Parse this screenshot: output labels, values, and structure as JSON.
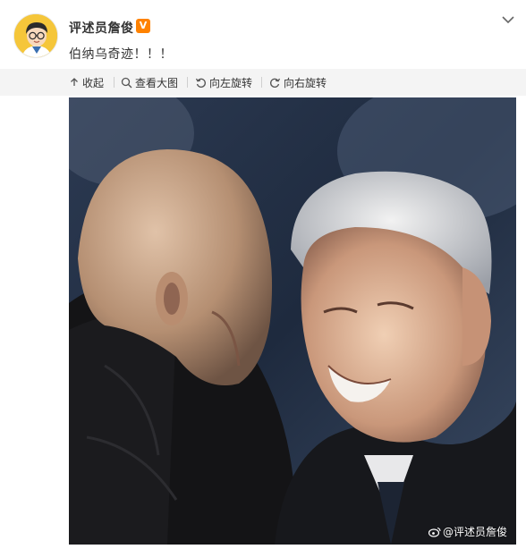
{
  "author": {
    "name": "评述员詹俊",
    "verified_badge": "V",
    "avatar_icon": "cartoon-avatar-icon"
  },
  "post": {
    "text": "伯纳乌奇迹！！！"
  },
  "toolbar": {
    "collapse_label": "收起",
    "view_large_label": "查看大图",
    "rotate_left_label": "向左旋转",
    "rotate_right_label": "向右旋转"
  },
  "photo": {
    "watermark": "@评述员詹俊"
  },
  "colors": {
    "badge": "#ff8200",
    "toolbar_bg": "#f4f4f4",
    "text": "#333333"
  }
}
